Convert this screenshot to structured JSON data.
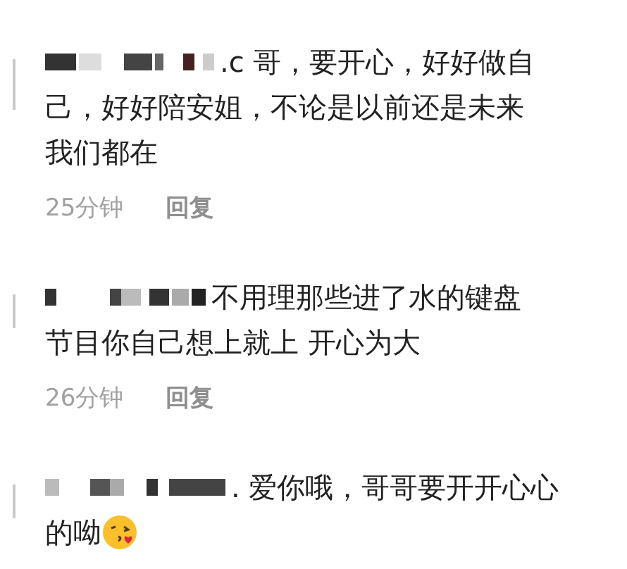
{
  "comments": [
    {
      "lines": [
        ".c 哥，要开心，好好做自",
        "己，好好陪安姐，不论是以前还是未来",
        "我们都在"
      ],
      "time": "25分钟",
      "reply": "回复"
    },
    {
      "lines": [
        "不用理那些进了水的键盘",
        "节目你自己想上就上 开心为大"
      ],
      "time": "26分钟",
      "reply": "回复"
    },
    {
      "lines": [
        ". 爱你哦，哥哥要开开心心",
        "的呦"
      ],
      "emoji": true
    }
  ]
}
